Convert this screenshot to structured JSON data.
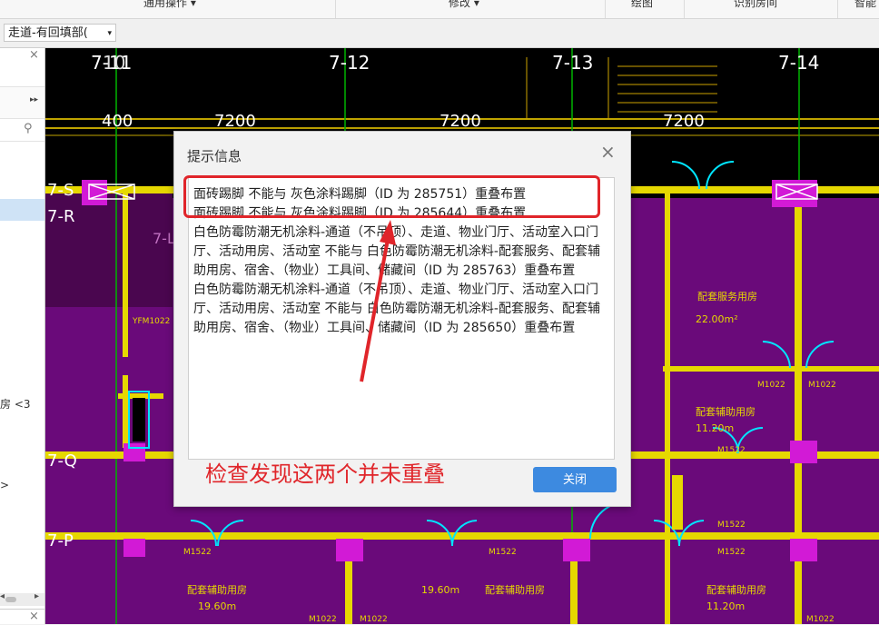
{
  "ribbon": {
    "groups": [
      {
        "label": "通用操作 ▾"
      },
      {
        "label": "修改 ▾"
      },
      {
        "label": "绘图"
      },
      {
        "label": "识别房间"
      },
      {
        "label": "智能"
      }
    ]
  },
  "toolbar": {
    "layer_combo_value": "走道-有回填部(",
    "layer_combo_arrow": "▾"
  },
  "left_panel": {
    "close": "×",
    "expand": "▸▸",
    "search_icon": "⚲",
    "item_room": "房 <3",
    "item_arrow": ">",
    "scroll_left": "◂",
    "scroll_right": "▸",
    "bottom_close": "×"
  },
  "cad": {
    "grid_top_labels": [
      "7-11",
      "7-12",
      "7-13",
      "7-14"
    ],
    "top_extra_label": "10",
    "grid_left_labels": [
      "7-S",
      "7-R",
      "7-Q",
      "7-P"
    ],
    "dimensions": [
      "400",
      "7200",
      "7200",
      "7200"
    ],
    "room_labels": [
      {
        "name": "配套服务用房",
        "area": "22.00m²"
      },
      {
        "name": "配套辅助用房",
        "area": "11.20m"
      },
      {
        "name": "配套辅助用房",
        "area": "19.60m"
      },
      {
        "name": "配套辅助用房",
        "area": "19.60m"
      },
      {
        "name": "配套辅助用房",
        "area": "11.20m"
      }
    ],
    "door_labels": [
      "YFM1022",
      "M1022",
      "M1022",
      "M1522",
      "M1522",
      "M1522",
      "M1522",
      "M1522",
      "M1022",
      "M1022",
      "M1022"
    ],
    "text_7L": "7-L",
    "colors": {
      "background": "#000000",
      "wall": "#e6d800",
      "room_fill": "#6a0a7a",
      "door": "#00e5ff",
      "grid": "#00c000"
    }
  },
  "dialog": {
    "title": "提示信息",
    "close": "×",
    "messages": [
      "面砖踢脚 不能与 灰色涂料踢脚（ID 为 285751）重叠布置",
      "面砖踢脚 不能与 灰色涂料踢脚（ID 为 285644）重叠布置",
      "白色防霉防潮无机涂料-通道（不吊顶）、走道、物业门厅、活动室入口门厅、活动用房、活动室 不能与 白色防霉防潮无机涂料-配套服务、配套辅助用房、宿舍、（物业）工具间、储藏间（ID 为 285763）重叠布置",
      "白色防霉防潮无机涂料-通道（不吊顶）、走道、物业门厅、活动室入口门厅、活动用房、活动室 不能与 白色防霉防潮无机涂料-配套服务、配套辅助用房、宿舍、（物业）工具间、储藏间（ID 为 285650）重叠布置"
    ],
    "close_button": "关闭"
  },
  "annotation": {
    "text": "检查发现这两个并未重叠",
    "color": "#e0252a"
  }
}
